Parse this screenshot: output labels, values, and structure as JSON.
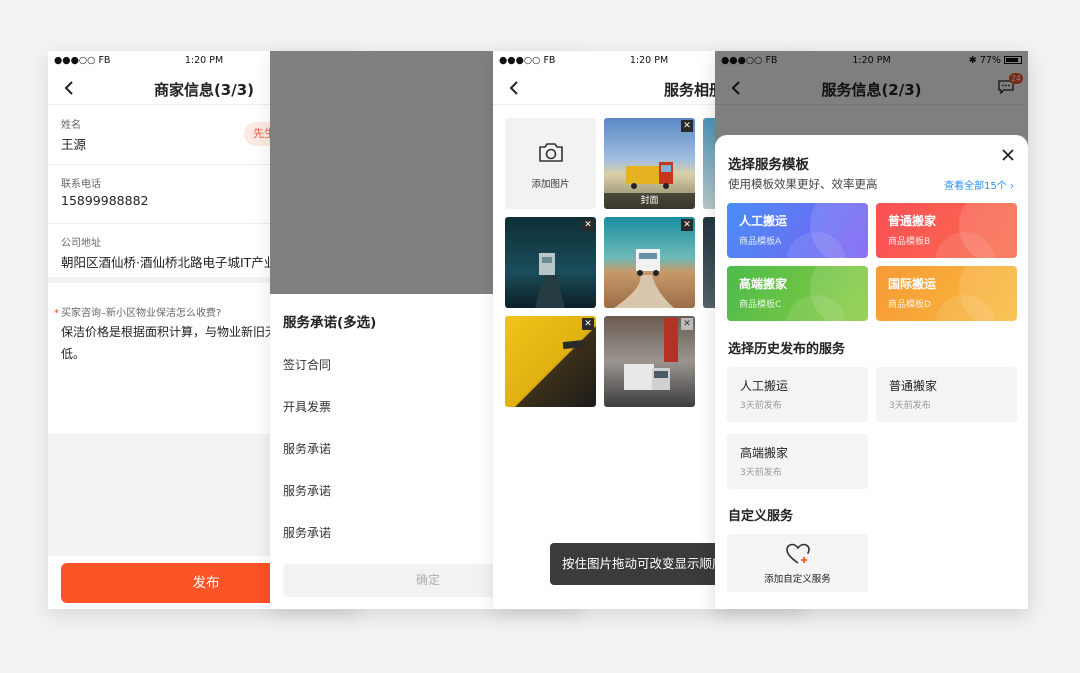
{
  "status_bar": {
    "carrier": "●●●○○ FB",
    "time": "1:20 PM",
    "battery": "77%"
  },
  "screen_merchant": {
    "nav_title": "商家信息(3/3)",
    "name_label": "姓名",
    "name_value": "王源",
    "first_tag": "先生",
    "phone_label": "联系电话",
    "phone_value": "15899988882",
    "address_label": "公司地址",
    "address_value": "朝阳区酒仙桥·酒仙桥北路电子城IT产业园",
    "question_label": "买家咨询–新小区物业保洁怎么收费?",
    "answer_text": "保洁价格是根据面积计算，与物业新旧无关，面积越大单价越低。",
    "publish_button": "发布"
  },
  "screen_commitment": {
    "sheet_title": "服务承诺(多选)",
    "options": [
      "签订合同",
      "开具发票",
      "服务承诺",
      "服务承诺",
      "服务承诺"
    ],
    "confirm_button": "确定"
  },
  "screen_album": {
    "nav_title": "服务相册",
    "add_photo_label": "添加图片",
    "cover_label": "封面",
    "toast_text": "按住图片拖动可改变显示顺序",
    "photo_icons": [
      "truck-photo",
      "truck-photo",
      "truck-photo",
      "truck-photo",
      "truck-photo"
    ]
  },
  "screen_service": {
    "nav_title": "服务信息(2/3)",
    "badge_count": "24",
    "modal_title": "选择服务模板",
    "modal_subtitle": "使用模板效果更好、效率更高",
    "view_all_link": "查看全部15个",
    "templates": [
      {
        "name": "人工搬运",
        "sub": "商品模板A",
        "color": "#5b7cf7"
      },
      {
        "name": "普通搬家",
        "sub": "商品模板B",
        "color": "#f8575a"
      },
      {
        "name": "高端搬家",
        "sub": "商品模板C",
        "color": "#5bbf46"
      },
      {
        "name": "国际搬运",
        "sub": "商品模板D",
        "color": "#f7a23a"
      }
    ],
    "history_title": "选择历史发布的服务",
    "history": [
      {
        "name": "人工搬运",
        "sub": "3天前发布"
      },
      {
        "name": "普通搬家",
        "sub": "3天前发布"
      },
      {
        "name": "高端搬家",
        "sub": "3天前发布"
      }
    ],
    "custom_title": "自定义服务",
    "custom_add_label": "添加自定义服务"
  }
}
